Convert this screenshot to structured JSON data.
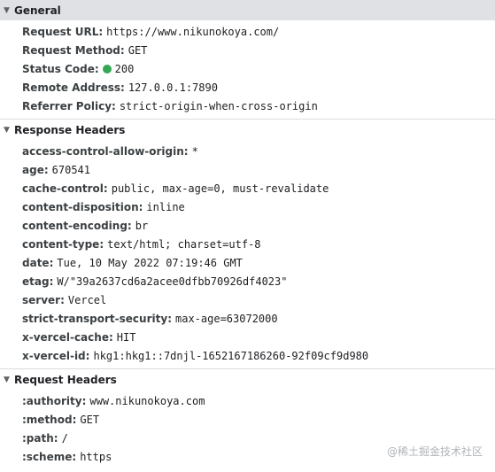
{
  "general": {
    "title": "General",
    "rows": [
      {
        "key": "Request URL",
        "value": "https://www.nikunokoya.com/"
      },
      {
        "key": "Request Method",
        "value": "GET"
      },
      {
        "key": "Status Code",
        "value": "200"
      },
      {
        "key": "Remote Address",
        "value": "127.0.0.1:7890"
      },
      {
        "key": "Referrer Policy",
        "value": "strict-origin-when-cross-origin"
      }
    ],
    "status_dot_color": "#34a853"
  },
  "response_headers": {
    "title": "Response Headers",
    "rows": [
      {
        "key": "access-control-allow-origin",
        "value": "*"
      },
      {
        "key": "age",
        "value": "670541"
      },
      {
        "key": "cache-control",
        "value": "public, max-age=0, must-revalidate"
      },
      {
        "key": "content-disposition",
        "value": "inline"
      },
      {
        "key": "content-encoding",
        "value": "br"
      },
      {
        "key": "content-type",
        "value": "text/html; charset=utf-8"
      },
      {
        "key": "date",
        "value": "Tue, 10 May 2022 07:19:46 GMT"
      },
      {
        "key": "etag",
        "value": "W/\"39a2637cd6a2acee0dfbb70926df4023\""
      },
      {
        "key": "server",
        "value": "Vercel"
      },
      {
        "key": "strict-transport-security",
        "value": "max-age=63072000"
      },
      {
        "key": "x-vercel-cache",
        "value": "HIT"
      },
      {
        "key": "x-vercel-id",
        "value": "hkg1:hkg1::7dnjl-1652167186260-92f09cf9d980"
      }
    ]
  },
  "request_headers": {
    "title": "Request Headers",
    "rows": [
      {
        "key": ":authority",
        "value": "www.nikunokoya.com"
      },
      {
        "key": ":method",
        "value": "GET"
      },
      {
        "key": ":path",
        "value": "/"
      },
      {
        "key": ":scheme",
        "value": "https"
      }
    ]
  },
  "watermark": "@稀土掘金技术社区",
  "icons": {
    "expanded": "triangle-down-icon",
    "status": "status-dot-icon"
  }
}
